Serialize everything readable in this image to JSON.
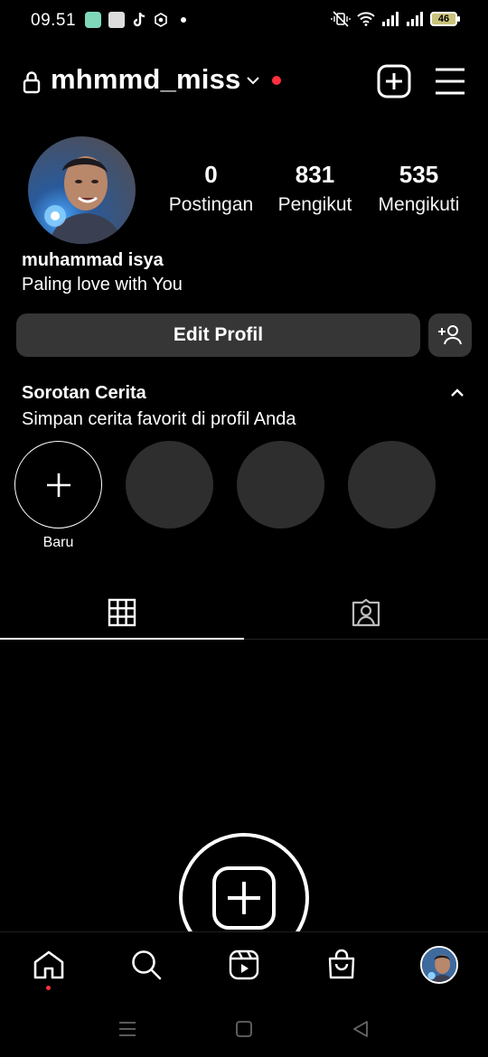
{
  "status_bar": {
    "time": "09.51",
    "battery": "46",
    "app_icons": [
      "messages-app-icon",
      "shop-app-icon",
      "tiktok-app-icon",
      "settings-app-icon",
      "notification-dot"
    ]
  },
  "header": {
    "username": "mhmmd_miss",
    "icons": [
      "lock-icon",
      "chevron-down-icon",
      "notification-dot",
      "add-post-icon",
      "menu-icon"
    ],
    "notification_color": "#ff3040"
  },
  "profile": {
    "full_name": "muhammad isya",
    "bio": "Paling love with You",
    "stats": [
      {
        "value": "0",
        "label": "Postingan"
      },
      {
        "value": "831",
        "label": "Pengikut"
      },
      {
        "value": "535",
        "label": "Mengikuti"
      }
    ],
    "edit_button": "Edit Profil"
  },
  "highlights": {
    "title": "Sorotan Cerita",
    "subtitle": "Simpan cerita favorit di profil Anda",
    "new_label": "Baru"
  },
  "tabs": [
    "grid-icon",
    "tagged-icon"
  ],
  "bottom_nav": [
    "home-icon",
    "search-icon",
    "reels-icon",
    "shop-icon",
    "profile-avatar"
  ],
  "colors": {
    "background": "#000000",
    "button": "#363636",
    "placeholder": "#2e2e2e",
    "accent_red": "#ff3040"
  }
}
